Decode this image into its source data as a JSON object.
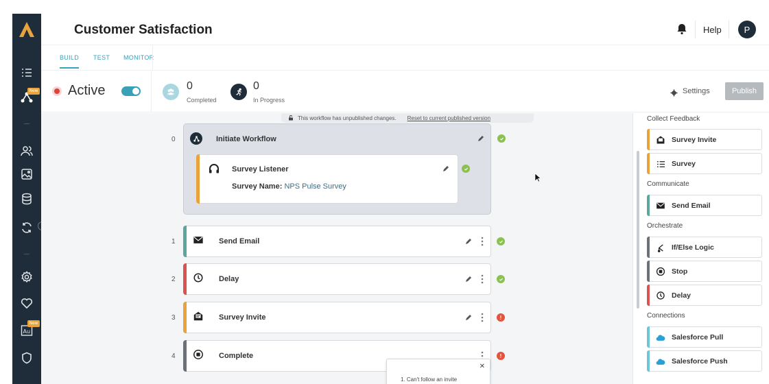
{
  "header": {
    "title": "Customer Satisfaction",
    "help_label": "Help",
    "avatar_initial": "P"
  },
  "sidebar": {
    "new_badge": "New"
  },
  "tabs": [
    {
      "label": "BUILD",
      "active": true
    },
    {
      "label": "TEST",
      "active": false
    },
    {
      "label": "MONITOR",
      "active": false
    }
  ],
  "status": {
    "state_label": "Active",
    "toggle_on": true,
    "completed_count": "0",
    "completed_label": "Completed",
    "in_progress_count": "0",
    "in_progress_label": "In Progress",
    "settings_label": "Settings",
    "publish_label": "Publish"
  },
  "canvas": {
    "banner_text": "This workflow has unpublished changes.",
    "banner_link": "Reset to current published version",
    "initiate": {
      "step": "0",
      "label": "Initiate Workflow",
      "listener_label": "Survey Listener",
      "survey_name_key": "Survey Name:",
      "survey_name_value": "NPS Pulse Survey"
    },
    "steps": [
      {
        "step": "1",
        "label": "Send Email",
        "status": "ok",
        "color": "#5ba89a",
        "icon": "mail-icon"
      },
      {
        "step": "2",
        "label": "Delay",
        "status": "ok",
        "color": "#d9534f",
        "icon": "clock-icon"
      },
      {
        "step": "3",
        "label": "Survey Invite",
        "status": "error",
        "color": "#e8a33d",
        "icon": "survey-invite-icon"
      },
      {
        "step": "4",
        "label": "Complete",
        "status": "error",
        "color": "#6c7177",
        "icon": "stop-icon"
      }
    ],
    "tooltip_text": "1. Can't follow an invite"
  },
  "panel": {
    "groups": [
      {
        "title": "Collect Feedback",
        "items": [
          {
            "label": "Survey Invite",
            "color": "#e8a33d",
            "icon": "survey-invite-icon"
          },
          {
            "label": "Survey",
            "color": "#e8a33d",
            "icon": "list-icon"
          }
        ]
      },
      {
        "title": "Communicate",
        "items": [
          {
            "label": "Send Email",
            "color": "#5ba89a",
            "icon": "mail-icon"
          }
        ]
      },
      {
        "title": "Orchestrate",
        "items": [
          {
            "label": "If/Else Logic",
            "color": "#6c7177",
            "icon": "branch-icon"
          },
          {
            "label": "Stop",
            "color": "#6c7177",
            "icon": "stop-icon"
          },
          {
            "label": "Delay",
            "color": "#d9534f",
            "icon": "clock-icon"
          }
        ]
      },
      {
        "title": "Connections",
        "items": [
          {
            "label": "Salesforce Pull",
            "color": "#6ec5d6",
            "icon": "salesforce-icon"
          },
          {
            "label": "Salesforce Push",
            "color": "#6ec5d6",
            "icon": "salesforce-icon"
          }
        ]
      }
    ]
  },
  "colors": {
    "accent": "#3aa0b8",
    "sidebar": "#1f2d3a",
    "ok": "#8cc152",
    "error": "#e5533d",
    "brand": "#e8a33d"
  }
}
